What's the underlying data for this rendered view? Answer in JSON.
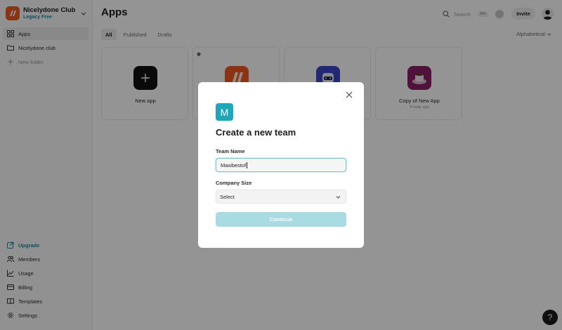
{
  "workspace": {
    "name": "Nicelydone Club",
    "plan": "Legacy Free"
  },
  "sidebar": {
    "top_items": [
      {
        "label": "Apps",
        "icon": "grid-icon"
      },
      {
        "label": "Nicelydone club",
        "icon": "folder-icon"
      },
      {
        "label": "New folder",
        "icon": "plus-icon"
      }
    ],
    "bottom_items": [
      {
        "label": "Upgrade",
        "icon": "upgrade-icon"
      },
      {
        "label": "Members",
        "icon": "members-icon"
      },
      {
        "label": "Usage",
        "icon": "usage-chart-icon"
      },
      {
        "label": "Billing",
        "icon": "billing-card-icon"
      },
      {
        "label": "Templates",
        "icon": "book-icon"
      },
      {
        "label": "Settings",
        "icon": "gear-icon"
      }
    ]
  },
  "header": {
    "title": "Apps",
    "search_placeholder": "Search",
    "search_shortcut": "⌘K",
    "invite_label": "Invite"
  },
  "tabs": [
    "All",
    "Published",
    "Drafts"
  ],
  "sort_label": "Alphabetical",
  "cards": [
    {
      "title": "New app",
      "subtitle": "",
      "icon": "plus-icon"
    },
    {
      "title": "",
      "subtitle": "",
      "icon": "app-logo-icon"
    },
    {
      "title": "",
      "subtitle": "",
      "icon": "robot-icon"
    },
    {
      "title": "Copy of New App",
      "subtitle": "Private app",
      "icon": "coffee-cup-icon"
    }
  ],
  "help_label": "?",
  "modal": {
    "badge_letter": "M",
    "title": "Create a new team",
    "team_name_label": "Team Name",
    "team_name_value": "Maxibestof",
    "company_size_label": "Company Size",
    "company_size_value": "Select",
    "continue_label": "Continue"
  },
  "colors": {
    "accent": "#20a6b9",
    "accent_text": "#1a8aa0",
    "continue_disabled": "#a9dbe3",
    "workspace_logo": "#ef5a24"
  }
}
